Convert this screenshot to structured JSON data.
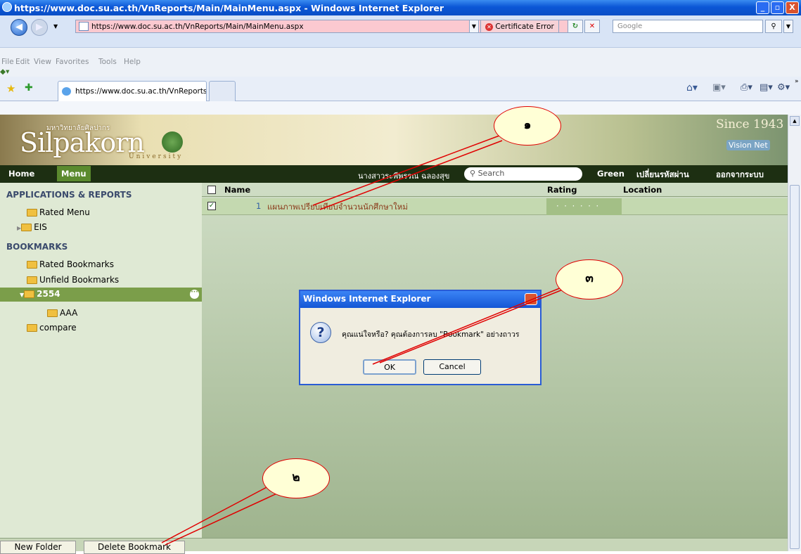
{
  "window": {
    "title": "https://www.doc.su.ac.th/VnReports/Main/MainMenu.aspx - Windows Internet Explorer"
  },
  "addressbar": {
    "url": "https://www.doc.su.ac.th/VnReports/Main/MainMenu.aspx",
    "cert_error": "Certificate Error",
    "search_placeholder": "Google"
  },
  "menubar": {
    "items": [
      "File",
      "Edit",
      "View",
      "Favorites",
      "Tools",
      "Help"
    ]
  },
  "tabs": [
    {
      "label": "https://www.doc.su.ac.th/VnReports/Main/MainMenu..."
    }
  ],
  "banner": {
    "since": "Since 1943",
    "vision": "Vision Net"
  },
  "nav": {
    "home": "Home",
    "menu": "Menu",
    "user": "นางสาวระพีพรรณ ฉลองสุข",
    "search_placeholder": "Search",
    "green": "Green",
    "change_password": "เปลี่ยนรหัสผ่าน",
    "logout": "ออกจากระบบ"
  },
  "sidebar": {
    "apps_heading": "APPLICATIONS & REPORTS",
    "rated_menu": "Rated Menu",
    "eis": "EIS",
    "bookmarks_heading": "BOOKMARKS",
    "rated_bookmarks": "Rated Bookmarks",
    "unfiled_bookmarks": "Unfield Bookmarks",
    "folder_2554": "2554",
    "folder_aaa": "AAA",
    "folder_compare": "compare"
  },
  "table": {
    "headers": {
      "name": "Name",
      "rating": "Rating",
      "location": "Location"
    },
    "rows": [
      {
        "num": "1",
        "name": "แผนภาพเปรียบเทียบจำนวนนักศึกษาใหม่",
        "rating": "· · · · · ·",
        "location": ""
      }
    ]
  },
  "dialog": {
    "title": "Windows Internet Explorer",
    "message": "คุณแน่ใจหรือ? คุณต้องการลบ \"Bookmark\" อย่างถาวร",
    "ok": "OK",
    "cancel": "Cancel"
  },
  "bottom": {
    "new_folder": "New Folder",
    "delete_bookmark": "Delete Bookmark"
  },
  "callouts": {
    "c1": "๑",
    "c2": "๒",
    "c3": "๓"
  },
  "colors": {
    "titlebar": "#0b56d6",
    "nav": "#1d2f12",
    "sidebar": "#dfe9d4",
    "callout_border": "#e00000"
  }
}
